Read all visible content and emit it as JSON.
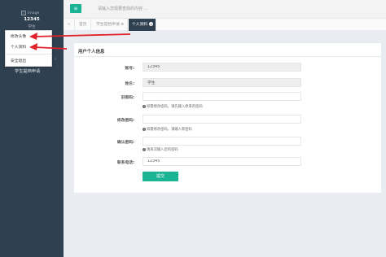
{
  "sidebar": {
    "avatar_alt": "image",
    "user_id": "12345",
    "user_role": "学生",
    "menu_item": "学生提档申请",
    "caret": "‹"
  },
  "dropdown": {
    "items": [
      "修改头像",
      "个人资料",
      "安全退出"
    ]
  },
  "topbar": {
    "menu_icon": "≡",
    "search_placeholder": "请输入您需要查找的内容 …"
  },
  "tabs": {
    "back_icon": "«",
    "items": [
      "首页",
      "学生提档申请 ⊗",
      "个人资料"
    ],
    "close_icon": "×"
  },
  "panel": {
    "title": "用户个人信息"
  },
  "form": {
    "account_label": "账号:",
    "account_value": "12345",
    "name_label": "姓名:",
    "name_value": "学生",
    "old_password_label": "旧密码:",
    "old_password_help": "如需修改密码，请先输入原来的密码",
    "new_password_label": "修改密码:",
    "new_password_help": "如需修改密码，请输入新密码",
    "confirm_label": "确认密码:",
    "confirm_help": "请再次输入您的密码",
    "phone_label": "联系电话:",
    "phone_value": "12345",
    "help_icon": "i",
    "submit_label": "提交"
  },
  "colors": {
    "sidebar_bg": "#2f4050",
    "accent": "#1ab394",
    "arrow": "#e0232b"
  }
}
